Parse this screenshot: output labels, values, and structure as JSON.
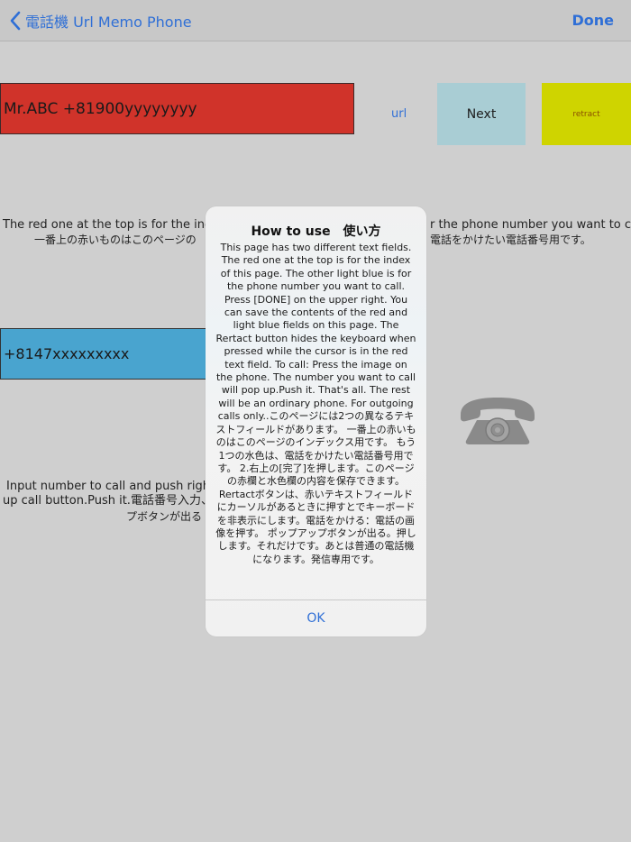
{
  "nav": {
    "back_label": "電話機 Url Memo Phone",
    "done_label": "Done"
  },
  "index_field": {
    "value": "Mr.ABC +81900yyyyyyyy"
  },
  "url_link": "url",
  "next_button": "Next",
  "retract_button": "retract",
  "index_description": {
    "line1_left": "The red one at the top is for the inde",
    "line2_left": "一番上の赤いものはこのページの",
    "line1_right": "r the phone number you want to call.",
    "line2_right": "電話をかけたい電話番号用です。"
  },
  "phone_field": {
    "value": "+8147xxxxxxxxx"
  },
  "input_description": {
    "line1": "Input  number to call and push right",
    "line2": "up call button.Push it.電話番号入力、",
    "line3": "プボタンが出る"
  },
  "phone_icon": "telephone-icon",
  "alert": {
    "title": "How to use　使い方",
    "message": "This page has two different text fields. The red one at the top is for the index of this page. The other light blue is for the phone number you want to call. Press [DONE] on the upper right. You can save the contents of the red and light blue fields on this page. The Rertact button hides the keyboard when pressed while the cursor is in the red text field.  To call: Press the image on the phone. The number you want to call will pop up.Push it. That's all. The rest will be an ordinary phone. For outgoing calls only..このページには2つの異なるテキストフィールドがあります。 一番上の赤いものはこのページのインデックス用です。 もう1つの水色は、電話をかけたい電話番号用です。 2.右上の[完了]を押します。このページの赤欄と水色欄の内容を保存できます。 Rertactボタンは、赤いテキストフィールドにカーソルがあるときに押すとでキーボードを非表示にします。電話をかける：電話の画像を押す。 ポップアップボタンが出る。押しします。それだけです。あとは普通の電話機になります。発信専用です。",
    "ok_label": "OK"
  },
  "colors": {
    "accent": "#2f6fd6",
    "index_field": "#d0332a",
    "phone_field": "#49a4cf",
    "next_button": "#a9cdd4",
    "retract_button": "#cfd400"
  }
}
